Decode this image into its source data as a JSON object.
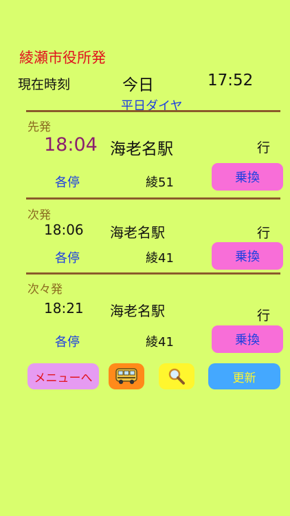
{
  "header": {
    "title": "綾瀬市役所発",
    "now_label": "現在時刻",
    "day_label": "今日",
    "current_time": "17:52",
    "schedule_type": "平日ダイヤ"
  },
  "departures": [
    {
      "label": "先発",
      "time": "18:04",
      "destination": "海老名駅",
      "direction": "行",
      "kind": "各停",
      "route": "綾51",
      "transfer": "乗換"
    },
    {
      "label": "次発",
      "time": "18:06",
      "destination": "海老名駅",
      "direction": "行",
      "kind": "各停",
      "route": "綾41",
      "transfer": "乗換"
    },
    {
      "label": "次々発",
      "time": "18:21",
      "destination": "海老名駅",
      "direction": "行",
      "kind": "各停",
      "route": "綾41",
      "transfer": "乗換"
    }
  ],
  "toolbar": {
    "menu_label": "メニューへ",
    "bus_icon": "bus-icon",
    "search_icon": "magnifier-icon",
    "refresh_label": "更新"
  },
  "colors": {
    "background": "#d9fe6e",
    "title": "#e0141e",
    "accent_blue": "#1d3fe0",
    "transfer_button": "#f86ed8",
    "menu_button": "#e69bf2",
    "bus_button": "#ff8a1a",
    "search_button": "#fff62e",
    "refresh_button": "#44a8ff"
  }
}
